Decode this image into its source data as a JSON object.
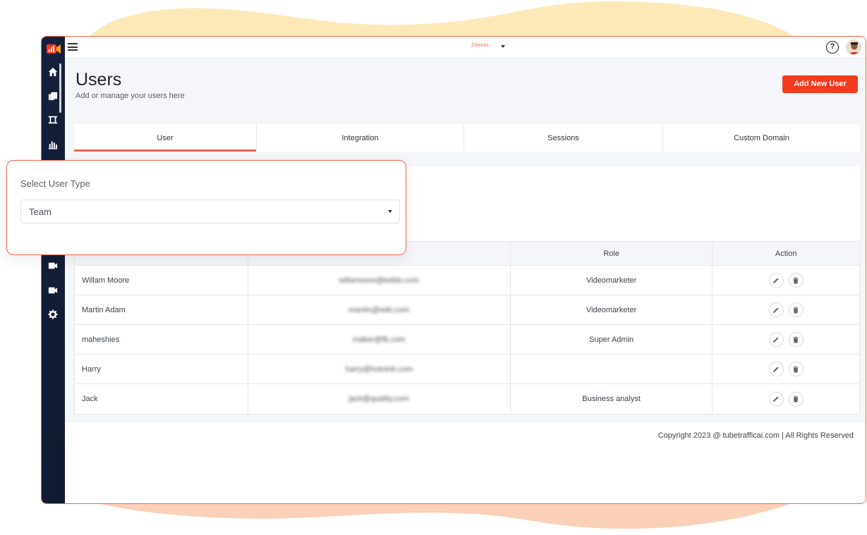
{
  "topbar": {
    "brand": "Zilexxc",
    "help_label": "?"
  },
  "page": {
    "title": "Users",
    "subtitle": "Add or manage your users here",
    "add_button": "Add New User"
  },
  "tabs": [
    {
      "label": "User",
      "active": true
    },
    {
      "label": "Integration",
      "active": false
    },
    {
      "label": "Sessions",
      "active": false
    },
    {
      "label": "Custom Domain",
      "active": false
    }
  ],
  "popup": {
    "label": "Select User Type",
    "selected": "Team"
  },
  "table": {
    "headers": [
      "",
      "",
      "Role",
      "Action"
    ],
    "rows": [
      {
        "name": "Willam Moore",
        "email": "willamoore@kiddo.com",
        "role": "Videomarketer"
      },
      {
        "name": "Martin Adam",
        "email": "mantin@wiki.com",
        "role": "Videomarketer"
      },
      {
        "name": "maheshies",
        "email": "maker@fb.com",
        "role": "Super Admin"
      },
      {
        "name": "Harry",
        "email": "harry@hotoink.com",
        "role": ""
      },
      {
        "name": "Jack",
        "email": "jack@quality.com",
        "role": "Business analyst"
      }
    ]
  },
  "footer": {
    "copyright": "Copyright 2023 @ tubetrafficai.com | All Rights Reserved"
  },
  "colors": {
    "accent": "#f33b1e",
    "border_accent": "#f26552",
    "sidebar": "#14203b",
    "blob_top": "#fde9b8",
    "blob_bottom": "#fbd0b8"
  }
}
